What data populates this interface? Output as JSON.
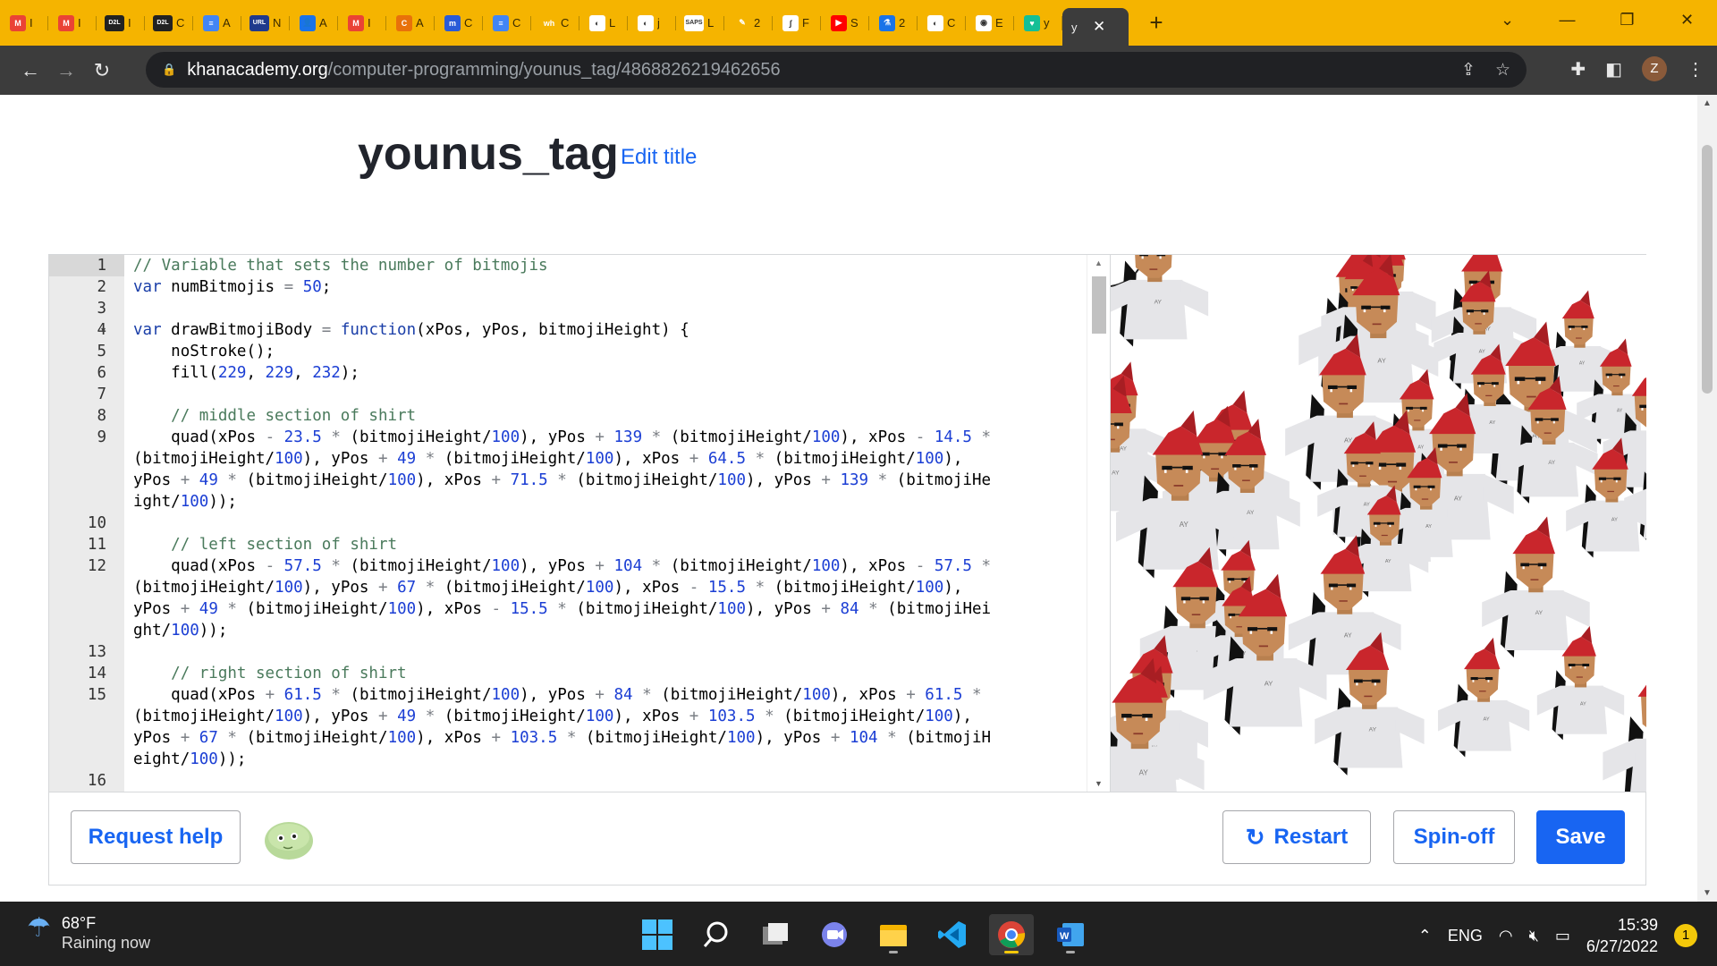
{
  "browser": {
    "tabs": [
      {
        "icon": "gmail-icon",
        "label": "I",
        "color": "#ea4335",
        "glyph": "M"
      },
      {
        "icon": "gmail-icon",
        "label": "I",
        "color": "#ea4335",
        "glyph": "M"
      },
      {
        "icon": "d2l-icon",
        "label": "I",
        "color": "#222222",
        "glyph": "D2L"
      },
      {
        "icon": "d2l-icon",
        "label": "C",
        "color": "#222222",
        "glyph": "D2L"
      },
      {
        "icon": "docs-icon",
        "label": "A",
        "color": "#4285f4",
        "glyph": "≡"
      },
      {
        "icon": "urlcs-icon",
        "label": "N",
        "color": "#203a8c",
        "glyph": "URL"
      },
      {
        "icon": "contacts-icon",
        "label": "A",
        "color": "#1a73e8",
        "glyph": "👤"
      },
      {
        "icon": "gmail-icon",
        "label": "I",
        "color": "#ea4335",
        "glyph": "M"
      },
      {
        "icon": "refresh-c-icon",
        "label": "A",
        "color": "#e8710a",
        "glyph": "C"
      },
      {
        "icon": "m-icon",
        "label": "C",
        "color": "#2a5bd7",
        "glyph": "m"
      },
      {
        "icon": "docs-icon",
        "label": "C",
        "color": "#4285f4",
        "glyph": "≡"
      },
      {
        "icon": "wh-icon",
        "label": "C",
        "color": "#f5b400",
        "glyph": "wh"
      },
      {
        "icon": "globe-icon",
        "label": "L",
        "color": "#ffffff",
        "glyph": "◐"
      },
      {
        "icon": "globe-icon",
        "label": "j",
        "color": "#ffffff",
        "glyph": "◐"
      },
      {
        "icon": "saps-icon",
        "label": "L",
        "color": "#ffffff",
        "glyph": "SAPS"
      },
      {
        "icon": "pen-icon",
        "label": "2",
        "color": "#f5b400",
        "glyph": "✎"
      },
      {
        "icon": "graph-icon",
        "label": "F",
        "color": "#ffffff",
        "glyph": "∫"
      },
      {
        "icon": "youtube-icon",
        "label": "S",
        "color": "#ff0000",
        "glyph": "▶"
      },
      {
        "icon": "flask-icon",
        "label": "2",
        "color": "#1a73e8",
        "glyph": "⚗"
      },
      {
        "icon": "globe-icon",
        "label": "C",
        "color": "#ffffff",
        "glyph": "◐"
      },
      {
        "icon": "github-icon",
        "label": "E",
        "color": "#ffffff",
        "glyph": "◉"
      },
      {
        "icon": "khan-icon",
        "label": "y",
        "color": "#14bf96",
        "glyph": "♥"
      }
    ],
    "active_tab": {
      "label": "y",
      "close": "✕"
    },
    "new_tab": "+",
    "window_buttons": [
      "⌄",
      "—",
      "❐",
      "✕"
    ],
    "url_host": "khanacademy.org",
    "url_path": "/computer-programming/younus_tag/4868826219462656",
    "profile_initial": "Z"
  },
  "page": {
    "title": "younus_tag",
    "edit_title": "Edit title"
  },
  "editor": {
    "line_numbers": [
      "1",
      "2",
      "3",
      "4",
      "5",
      "6",
      "7",
      "8",
      "9",
      "10",
      "11",
      "12",
      "13",
      "14",
      "15",
      "16"
    ],
    "code_lines": [
      "// Variable that sets the number of bitmojis",
      "var numBitmojis = 50;",
      "",
      "var drawBitmojiBody = function(xPos, yPos, bitmojiHeight) {",
      "    noStroke();",
      "    fill(229, 229, 232);",
      "",
      "    // middle section of shirt",
      "    quad(xPos - 23.5 * (bitmojiHeight/100), yPos + 139 * (bitmojiHeight/100), xPos - 14.5 *",
      "(bitmojiHeight/100), yPos + 49 * (bitmojiHeight/100), xPos + 64.5 * (bitmojiHeight/100),",
      "yPos + 49 * (bitmojiHeight/100), xPos + 71.5 * (bitmojiHeight/100), yPos + 139 * (bitmojiHe",
      "ight/100));",
      "",
      "    // left section of shirt",
      "    quad(xPos - 57.5 * (bitmojiHeight/100), yPos + 104 * (bitmojiHeight/100), xPos - 57.5 *",
      "(bitmojiHeight/100), yPos + 67 * (bitmojiHeight/100), xPos - 15.5 * (bitmojiHeight/100),",
      "yPos + 49 * (bitmojiHeight/100), xPos - 15.5 * (bitmojiHeight/100), yPos + 84 * (bitmojiHei",
      "ght/100));",
      "",
      "    // right section of shirt",
      "    quad(xPos + 61.5 * (bitmojiHeight/100), yPos + 84 * (bitmojiHeight/100), xPos + 61.5 *",
      "(bitmojiHeight/100), yPos + 49 * (bitmojiHeight/100), xPos + 103.5 * (bitmojiHeight/100),",
      "yPos + 67 * (bitmojiHeight/100), xPos + 103.5 * (bitmojiHeight/100), yPos + 104 * (bitmojiH",
      "eight/100));",
      ""
    ],
    "shirt_label": "AY"
  },
  "buttons": {
    "request_help": "Request help",
    "restart": "Restart",
    "spinoff": "Spin-off",
    "save": "Save"
  },
  "taskbar": {
    "temperature": "68°F",
    "weather": "Raining now",
    "language": "ENG",
    "time": "15:39",
    "date": "6/27/2022",
    "notification_count": "1"
  }
}
